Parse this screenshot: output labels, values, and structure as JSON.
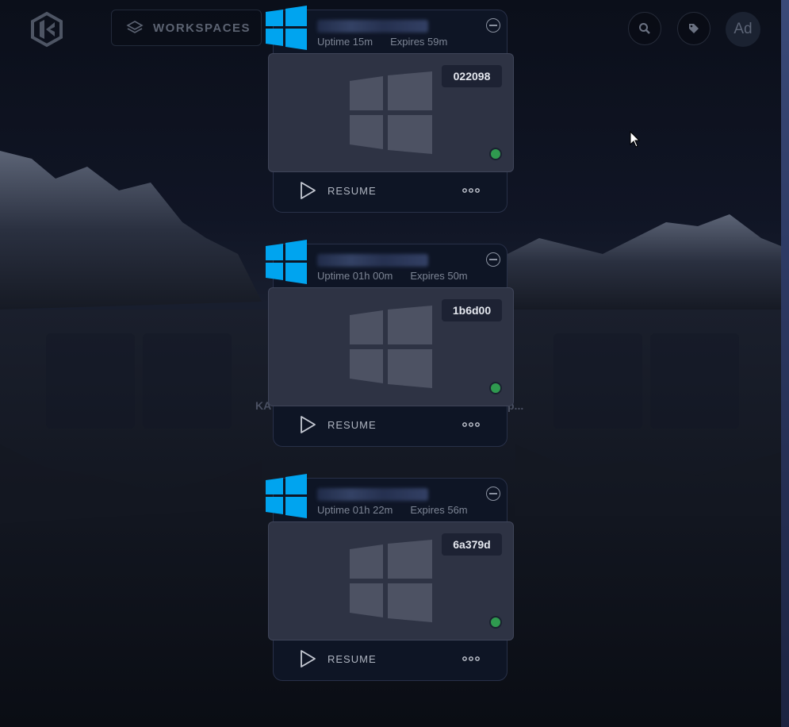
{
  "header": {
    "workspaces_label": "WORKSPACES",
    "avatar_initials": "Ad",
    "icons": [
      "kasm-logo-icon",
      "layers-icon",
      "search-icon",
      "tag-icon"
    ]
  },
  "background": {
    "partial_text_left": "KA",
    "partial_text_right": "p..."
  },
  "sessions": [
    {
      "uptime": "Uptime 15m",
      "expires": "Expires 59m",
      "id": "022098",
      "resume_label": "RESUME",
      "status": "running"
    },
    {
      "uptime": "Uptime 01h 00m",
      "expires": "Expires 50m",
      "id": "1b6d00",
      "resume_label": "RESUME",
      "status": "running"
    },
    {
      "uptime": "Uptime 01h 22m",
      "expires": "Expires 56m",
      "id": "6a379d",
      "resume_label": "RESUME",
      "status": "running"
    }
  ],
  "colors": {
    "windows_blue": "#00a4ef",
    "status_green": "#2f9a4f",
    "card_bg": "#0e1525"
  }
}
